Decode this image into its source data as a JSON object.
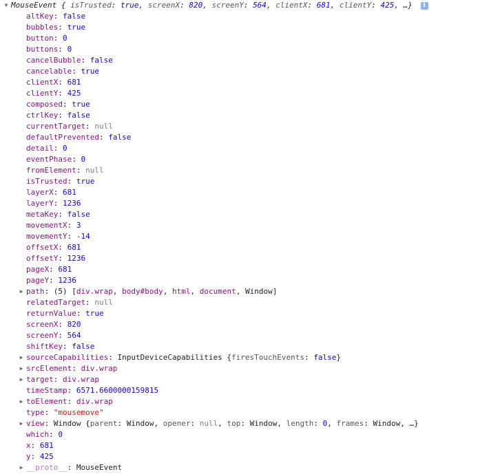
{
  "header": {
    "type": "MouseEvent",
    "open_brace": "{",
    "fields": [
      {
        "key": "isTrusted",
        "value": "true"
      },
      {
        "key": "screenX",
        "value": "820"
      },
      {
        "key": "screenY",
        "value": "564"
      },
      {
        "key": "clientX",
        "value": "681"
      },
      {
        "key": "clientY",
        "value": "425"
      }
    ],
    "ellipsis": "…}",
    "info_icon_glyph": "i"
  },
  "properties": [
    {
      "key": "altKey",
      "value": "false",
      "kind": "bool"
    },
    {
      "key": "bubbles",
      "value": "true",
      "kind": "bool"
    },
    {
      "key": "button",
      "value": "0",
      "kind": "num"
    },
    {
      "key": "buttons",
      "value": "0",
      "kind": "num"
    },
    {
      "key": "cancelBubble",
      "value": "false",
      "kind": "bool"
    },
    {
      "key": "cancelable",
      "value": "true",
      "kind": "bool"
    },
    {
      "key": "clientX",
      "value": "681",
      "kind": "num"
    },
    {
      "key": "clientY",
      "value": "425",
      "kind": "num"
    },
    {
      "key": "composed",
      "value": "true",
      "kind": "bool"
    },
    {
      "key": "ctrlKey",
      "value": "false",
      "kind": "bool"
    },
    {
      "key": "currentTarget",
      "value": "null",
      "kind": "nul"
    },
    {
      "key": "defaultPrevented",
      "value": "false",
      "kind": "bool"
    },
    {
      "key": "detail",
      "value": "0",
      "kind": "num"
    },
    {
      "key": "eventPhase",
      "value": "0",
      "kind": "num"
    },
    {
      "key": "fromElement",
      "value": "null",
      "kind": "nul"
    },
    {
      "key": "isTrusted",
      "value": "true",
      "kind": "bool"
    },
    {
      "key": "layerX",
      "value": "681",
      "kind": "num"
    },
    {
      "key": "layerY",
      "value": "1236",
      "kind": "num"
    },
    {
      "key": "metaKey",
      "value": "false",
      "kind": "bool"
    },
    {
      "key": "movementX",
      "value": "3",
      "kind": "num"
    },
    {
      "key": "movementY",
      "value": "-14",
      "kind": "num"
    },
    {
      "key": "offsetX",
      "value": "681",
      "kind": "num"
    },
    {
      "key": "offsetY",
      "value": "1236",
      "kind": "num"
    },
    {
      "key": "pageX",
      "value": "681",
      "kind": "num"
    },
    {
      "key": "pageY",
      "value": "1236",
      "kind": "num"
    },
    {
      "key": "path",
      "expandable": true,
      "kind": "array",
      "count": "(5)",
      "items": [
        "div.wrap",
        "body#body",
        "html",
        "document",
        "Window"
      ]
    },
    {
      "key": "relatedTarget",
      "value": "null",
      "kind": "nul"
    },
    {
      "key": "returnValue",
      "value": "true",
      "kind": "bool"
    },
    {
      "key": "screenX",
      "value": "820",
      "kind": "num"
    },
    {
      "key": "screenY",
      "value": "564",
      "kind": "num"
    },
    {
      "key": "shiftKey",
      "value": "false",
      "kind": "bool"
    },
    {
      "key": "sourceCapabilities",
      "expandable": true,
      "kind": "object",
      "class_name": "InputDeviceCapabilities",
      "fields": [
        {
          "key": "firesTouchEvents",
          "value": "false",
          "kind": "bool"
        }
      ]
    },
    {
      "key": "srcElement",
      "value": "div.wrap",
      "kind": "node",
      "expandable": true
    },
    {
      "key": "target",
      "value": "div.wrap",
      "kind": "node",
      "expandable": true
    },
    {
      "key": "timeStamp",
      "value": "6571.6600000159815",
      "kind": "num"
    },
    {
      "key": "toElement",
      "value": "div.wrap",
      "kind": "node",
      "expandable": true
    },
    {
      "key": "type",
      "value": "\"mousemove\"",
      "kind": "str"
    },
    {
      "key": "view",
      "expandable": true,
      "kind": "object",
      "class_name": "Window",
      "fields": [
        {
          "key": "parent",
          "value": "Window",
          "kind": "plain"
        },
        {
          "key": "opener",
          "value": "null",
          "kind": "nul"
        },
        {
          "key": "top",
          "value": "Window",
          "kind": "plain"
        },
        {
          "key": "length",
          "value": "0",
          "kind": "num"
        },
        {
          "key": "frames",
          "value": "Window",
          "kind": "plain"
        }
      ],
      "truncated": true
    },
    {
      "key": "which",
      "value": "0",
      "kind": "num"
    },
    {
      "key": "x",
      "value": "681",
      "kind": "num"
    },
    {
      "key": "y",
      "value": "425",
      "kind": "num"
    },
    {
      "key": "__proto__",
      "value": "MouseEvent",
      "kind": "plain",
      "expandable": true,
      "dim": true
    }
  ],
  "triangles": {
    "expanded": "▼",
    "collapsed": "▶"
  }
}
